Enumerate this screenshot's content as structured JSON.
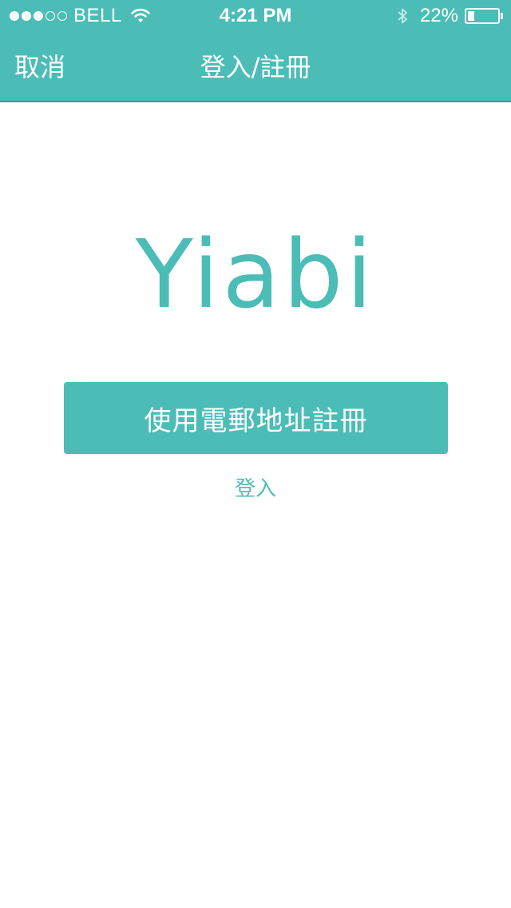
{
  "status_bar": {
    "signal_bars_on": 3,
    "signal_bars_total": 5,
    "carrier": "BELL",
    "time": "4:21 PM",
    "battery_percent_label": "22%",
    "battery_level": 0.22,
    "icons": [
      "wifi-icon",
      "bluetooth-icon",
      "battery-icon"
    ]
  },
  "nav": {
    "cancel_label": "取消",
    "title": "登入/註冊"
  },
  "logo": {
    "text": "Yiabi"
  },
  "signup_button": {
    "label": "使用電郵地址註冊"
  },
  "login_link": {
    "label": "登入"
  },
  "colors": {
    "accent": "#4bbdb6",
    "background": "#ffffff",
    "text_on_accent": "#ffffff"
  }
}
